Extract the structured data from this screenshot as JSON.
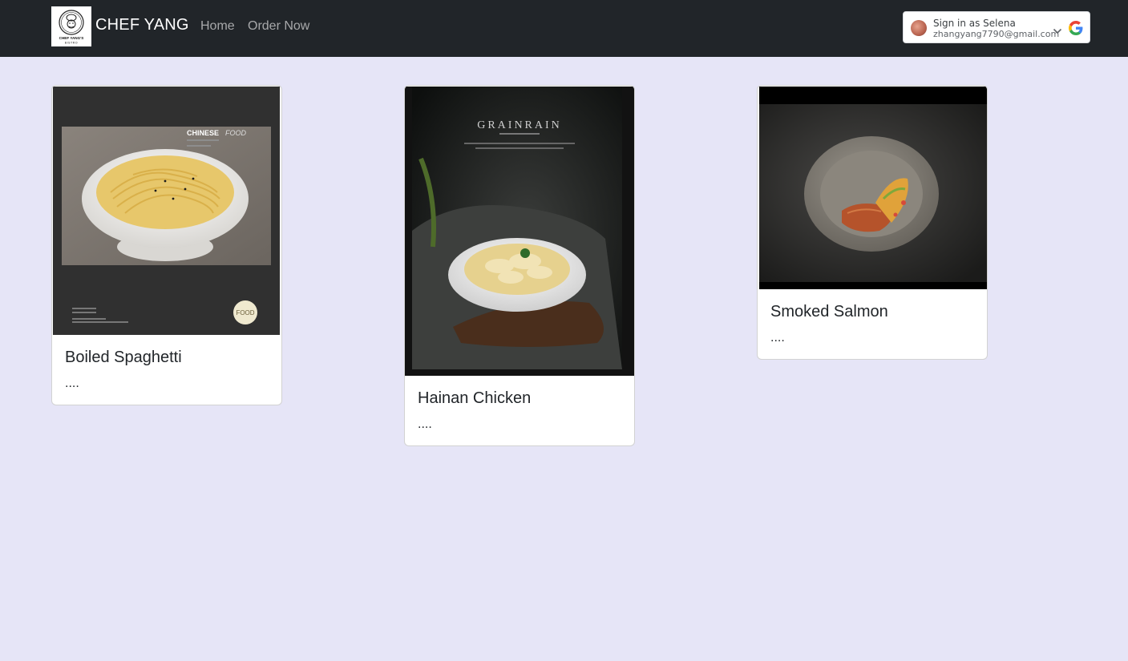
{
  "navbar": {
    "brand_name": "CHEF YANG",
    "logo_text_line1": "CHEF YANG'S",
    "logo_text_line2": "BISTRO",
    "links": [
      {
        "label": "Home"
      },
      {
        "label": "Order Now"
      }
    ]
  },
  "google_signin": {
    "title": "Sign in as Selena",
    "email": "zhangyang7790@gmail.com",
    "icon": "google-logo-icon"
  },
  "cards": [
    {
      "title": "Boiled Spaghetti",
      "text": "....",
      "image_text": {
        "heading": "CHINESE",
        "heading_italic": "FOOD",
        "badge": "FOOD"
      }
    },
    {
      "title": "Hainan Chicken",
      "text": "....",
      "image_text": {
        "heading": "GRAINRAIN"
      }
    },
    {
      "title": "Smoked Salmon",
      "text": "...."
    }
  ],
  "colors": {
    "navbar_bg": "#212529",
    "page_bg": "#e6e5f7",
    "card_bg": "#ffffff",
    "text": "#212529"
  }
}
